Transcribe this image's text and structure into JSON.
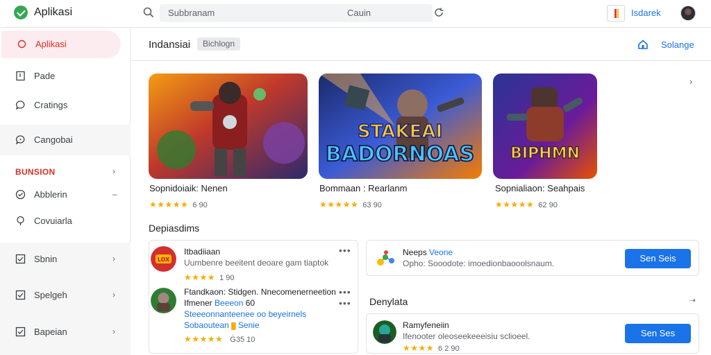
{
  "topbar": {
    "app_title": "Aplikasi",
    "search_placeholder": "Subbranam",
    "search_right": "Cauin",
    "user_name": "Isdarek"
  },
  "sidebar": {
    "items": [
      {
        "label": "Aplikasi",
        "icon": "circle-icon",
        "active": true
      },
      {
        "label": "Pade",
        "icon": "document-icon"
      },
      {
        "label": "Cratings",
        "icon": "chat-icon"
      },
      {
        "label": "Cangobai",
        "icon": "comment-icon"
      }
    ],
    "section_label": "BUNSION",
    "section_items": [
      {
        "label": "Abblerin",
        "icon": "check-circle-icon"
      },
      {
        "label": "Covuiarla",
        "icon": "pin-icon"
      },
      {
        "label": "Sbnin",
        "icon": "checkbox-icon"
      },
      {
        "label": "Spelgeh",
        "icon": "checkbox-icon"
      },
      {
        "label": "Bapeian",
        "icon": "checkbox-icon"
      }
    ]
  },
  "main": {
    "page_title": "Indansiai",
    "chip_label": "Bichlogn",
    "header_link": "Solange",
    "cards": [
      {
        "name": "Sopnidoiaik: Nenen",
        "rating": "★★★★★",
        "size": "6 90"
      },
      {
        "name": "Bommaan : Rearlanm",
        "rating": "★★★★★",
        "size": "63 90",
        "art_title_1": "STAKEAI",
        "art_title_2": "BADORNOAS"
      },
      {
        "name": "Sopnialiaon: Seahpais",
        "rating": "★★★★★",
        "size": "62 90",
        "art_title": "BIPHMN"
      }
    ],
    "section_left_title": "Depiasdims",
    "list_items": [
      {
        "title": "Itbadiiaan",
        "description": "Uumbenre beeitent deoare gam tiaptok",
        "rating": "★★★★",
        "size": "1 90",
        "icon_text": "LOX"
      },
      {
        "title": "Ftandkaon: Stidgen. Nnecomenerneetion",
        "title2_plain": "Ifmener",
        "title2_blue": "Beeeon",
        "title2_tail": "60",
        "description_blue": "Steeeonnanteenee oo beyeirnels",
        "tag_blue": "Sobaoutean",
        "tag_sep": "█",
        "tag_tail_blue": "Senie",
        "rating": "★★★★★",
        "size": "Ġ35 10"
      }
    ],
    "promo_1": {
      "title_plain": "Neeps",
      "title_blue": "Veone",
      "description": "Opho: Sooodote: imoedionbaooolsnaum.",
      "button": "Sen Seis"
    },
    "section_right_title": "Denylata",
    "promo_2": {
      "title": "Ramyfeneiin",
      "description": "Ifenooter oleoseekeeeisiu sclioeel.",
      "rating": "★★★★",
      "size": "6 2 90",
      "button": "Sen Ses"
    }
  },
  "colors": {
    "accent": "#1a73e8",
    "active_red": "#d93025",
    "star": "#f9ab00"
  }
}
